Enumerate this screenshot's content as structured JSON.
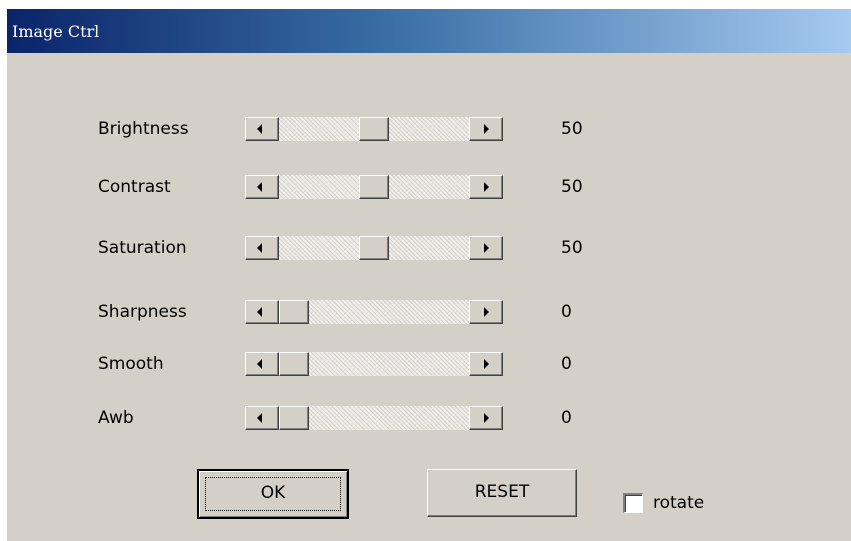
{
  "window": {
    "title": "Image Ctrl"
  },
  "controls": [
    {
      "label": "Brightness",
      "value": "50",
      "level_percent": 50
    },
    {
      "label": "Contrast",
      "value": "50",
      "level_percent": 50
    },
    {
      "label": "Saturation",
      "value": "50",
      "level_percent": 50
    },
    {
      "label": "Sharpness",
      "value": "0",
      "level_percent": 0
    },
    {
      "label": "Smooth",
      "value": "0",
      "level_percent": 0
    },
    {
      "label": "Awb",
      "value": "0",
      "level_percent": 0
    }
  ],
  "buttons": {
    "ok_label": "OK",
    "reset_label": "RESET"
  },
  "rotate": {
    "label": "rotate",
    "checked": false
  },
  "colors": {
    "title_gradient_start": "#0a246a",
    "title_gradient_end": "#a6caf0",
    "dialog_background": "#d4d0c8"
  }
}
